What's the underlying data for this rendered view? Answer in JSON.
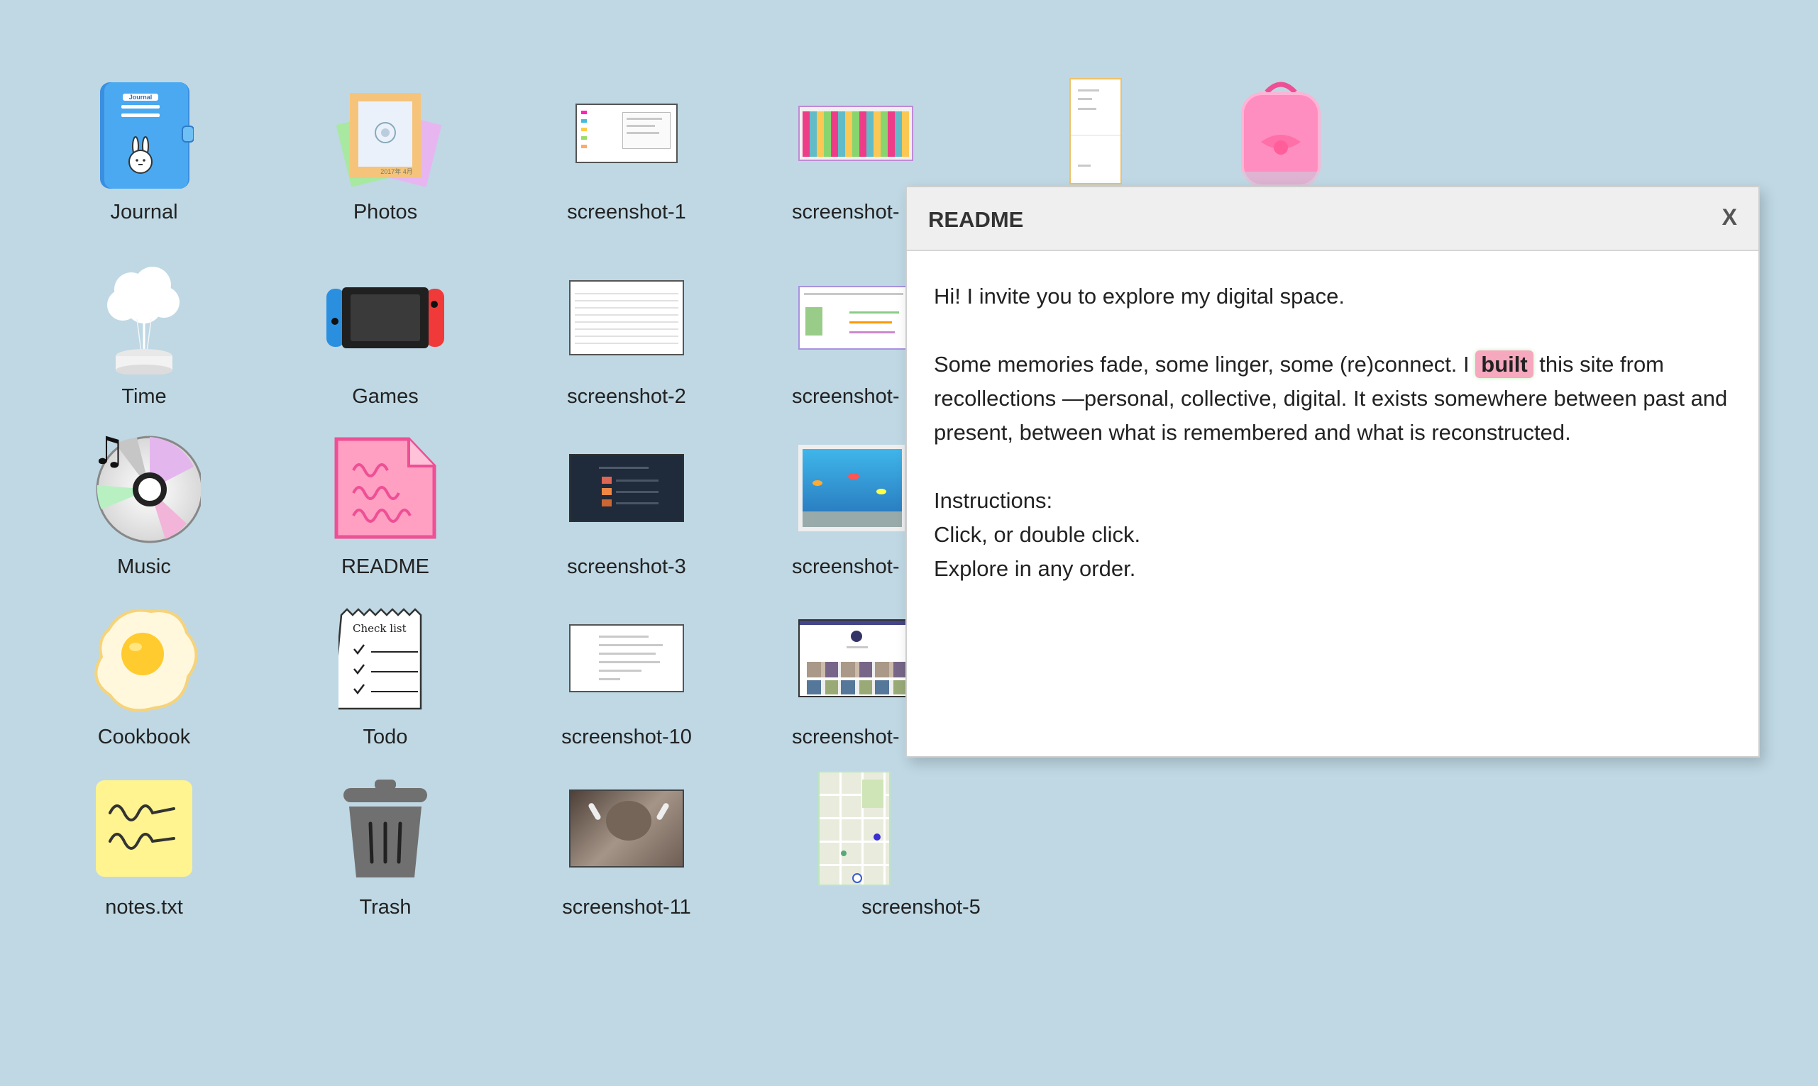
{
  "desktop": {
    "icons": {
      "journal": "Journal",
      "photos": "Photos",
      "screenshot_1": "screenshot-1",
      "screenshot_top4": "screenshot-",
      "time": "Time",
      "games": "Games",
      "screenshot_2": "screenshot-2",
      "screenshot_row2_4": "screenshot-",
      "music": "Music",
      "readme": "README",
      "screenshot_3": "screenshot-3",
      "screenshot_row3_4": "screenshot-",
      "cookbook": "Cookbook",
      "todo": "Todo",
      "screenshot_10": "screenshot-10",
      "screenshot_row4_4": "screenshot-",
      "notes": "notes.txt",
      "trash": "Trash",
      "screenshot_11": "screenshot-11",
      "screenshot_5": "screenshot-5"
    },
    "journal_cover_text": "Journal",
    "todo_header_text": "Check list",
    "photos_caption": "2017年 4月"
  },
  "readme_window": {
    "title": "README",
    "close_label": "X",
    "para1": "Hi! I invite you to explore my digital space.",
    "para2_before": "Some memories fade, some linger, some (re)connect. I ",
    "para2_highlight": "built",
    "para2_after": " this site from recollections —personal, collective, digital. It exists somewhere between past and present, between what is remembered and what is reconstructed.",
    "instructions_heading": "Instructions:",
    "instruction_1": "Click, or double click.",
    "instruction_2": "Explore in any order."
  },
  "colors": {
    "background": "#bfd8e4",
    "highlight": "#f6a8bf"
  }
}
